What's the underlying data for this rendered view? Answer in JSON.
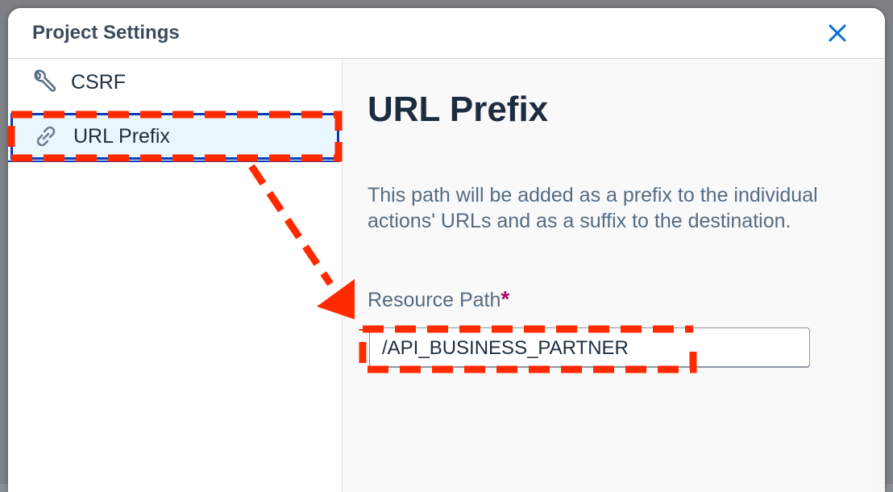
{
  "dialog": {
    "title": "Project Settings",
    "close_icon": "close-icon",
    "accent_color": "#0a6ed1"
  },
  "sidebar": {
    "items": [
      {
        "label": "CSRF",
        "icon": "wrench-icon",
        "selected": false
      },
      {
        "label": "URL Prefix",
        "icon": "link-icon",
        "selected": true
      }
    ]
  },
  "main": {
    "heading": "URL Prefix",
    "description": "This path will be added as a prefix to the individual actions' URLs and as a suffix to the destination.",
    "field": {
      "label": "Resource Path",
      "required_marker": "*",
      "value": "/API_BUSINESS_PARTNER"
    }
  },
  "annotation": {
    "color": "#ff2a00",
    "style": "dashed"
  }
}
